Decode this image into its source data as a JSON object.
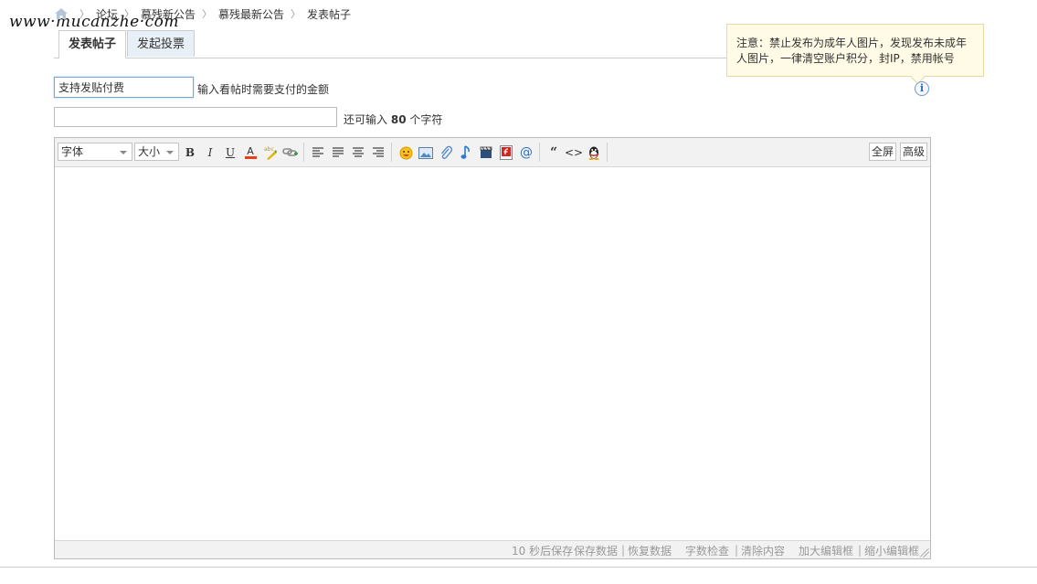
{
  "watermark": "www·mucanzhe·com",
  "breadcrumb": {
    "items": [
      "论坛",
      "慕残新公告",
      "慕残最新公告",
      "发表帖子"
    ]
  },
  "tabs": [
    {
      "label": "发表帖子",
      "active": true
    },
    {
      "label": "发起投票",
      "active": false
    }
  ],
  "price": {
    "value": "支持发贴付费",
    "hint": "输入看帖时需要支付的金额"
  },
  "title": {
    "value": "",
    "hint_prefix": "还可输入",
    "remaining": "80",
    "hint_suffix": "个字符"
  },
  "notice": {
    "text": "注意：禁止发布为成年人图片，发现发布未成年人图片，一律清空账户积分，封IP，禁用帐号"
  },
  "info_icon": "i",
  "toolbar": {
    "font_select": "字体",
    "size_select": "大小",
    "bold": "B",
    "italic": "I",
    "underline": "U",
    "color": "A",
    "quote": "“",
    "code": "<>",
    "fullscreen": "全屏",
    "advanced": "高级"
  },
  "statusbar": {
    "autosave": "10 秒后保存",
    "save": "保存数据",
    "restore": "恢复数据",
    "check": "字数检查",
    "clear": "清除内容",
    "enlarge": "加大编辑框",
    "shrink": "缩小编辑框"
  },
  "colors": {
    "tab_bg": "#e8f0f7",
    "notice_bg": "#fffbe6",
    "toolbar_bg": "#f2f2f2",
    "focus_border": "#7aa7d6"
  }
}
